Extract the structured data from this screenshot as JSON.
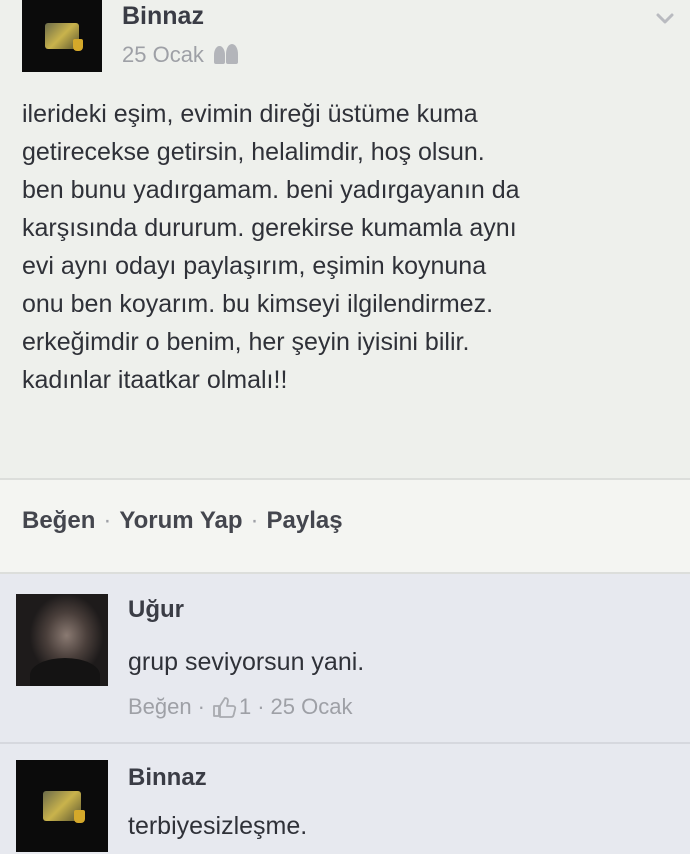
{
  "post": {
    "author": "Binnaz",
    "date": "25 Ocak",
    "audience_icon": "friends-icon",
    "menu_icon": "chevron-down-icon",
    "text": "ilerideki eşim, evimin direği üstüme kuma\ngetirecekse getirsin, helalimdir, hoş olsun.\nben bunu yadırgamam. beni yadırgayanın da\nkarşısında dururum. gerekirse kumamla aynı\nevi aynı odayı paylaşırım, eşimin koynuna\nonu ben koyarım. bu kimseyi ilgilendirmez.\nerkeğimdir o benim, her şeyin iyisini bilir.\nkadınlar itaatkar olmalı!!"
  },
  "actions": {
    "like": "Beğen",
    "comment": "Yorum Yap",
    "share": "Paylaş",
    "separator": "·"
  },
  "comments": [
    {
      "author": "Uğur",
      "text": "grup seviyorsun yani.",
      "like_label": "Beğen",
      "like_icon": "thumbs-up-icon",
      "like_count": "1",
      "date": "25 Ocak",
      "separator": "·"
    },
    {
      "author": "Binnaz",
      "text": "terbiyesizleşme."
    }
  ]
}
